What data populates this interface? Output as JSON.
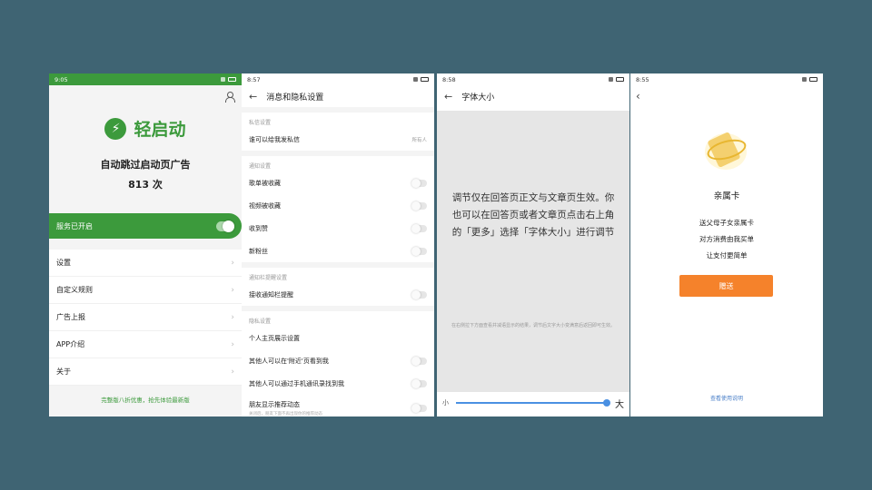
{
  "colors": {
    "background": "#3f6473",
    "accent_green": "#3c9a3c",
    "accent_orange": "#f5822b",
    "link_blue": "#4a7fc8",
    "slider_blue": "#4a90e2"
  },
  "phone1": {
    "time": "9:05",
    "brand_icon": "lightning-bolt-icon",
    "brand_name": "轻启动",
    "subtitle": "自动跳过启动页广告",
    "count": "813 次",
    "service_label": "服务已开启",
    "service_enabled": true,
    "menu": [
      {
        "label": "设置"
      },
      {
        "label": "自定义规则"
      },
      {
        "label": "广告上报"
      },
      {
        "label": "APP介绍"
      },
      {
        "label": "关于"
      }
    ],
    "footer": "完整版八折优惠，抢先体验最新版"
  },
  "phone2": {
    "time": "8:57",
    "title": "消息和隐私设置",
    "sections": {
      "private_msg_header": "私信设置",
      "private_msg_row": {
        "label": "谁可以给我发私信",
        "value": "所有人"
      },
      "notify_header": "通知设置",
      "notify_rows": [
        "歌单被收藏",
        "视频被收藏",
        "收到赞",
        "新粉丝"
      ],
      "bar_header": "通知栏提醒设置",
      "bar_row": "接收通知栏提醒",
      "privacy_header": "隐私设置",
      "privacy_rows": [
        "个人主页展示设置",
        "其他人可以在'附近'页看到我",
        "其他人可以通过手机通讯录找到我"
      ],
      "friend_row": {
        "label": "朋友显示推荐动态",
        "sub": "关闭后，朋友下面不再出现你的推荐动态"
      }
    }
  },
  "phone3": {
    "time": "8:58",
    "title": "字体大小",
    "main_text": "调节仅在回答页正文与文章页生效。你也可以在回答页或者文章页点击右上角的「更多」选择「字体大小」进行调节",
    "note": "在右侧拉下方面查看并减语显示的结果，调节后文字大小变满意后返回即可生效。",
    "slider_min": "小",
    "slider_max": "大",
    "slider_value": 1.0
  },
  "phone4": {
    "time": "8:55",
    "title": "亲属卡",
    "lines": [
      "送父母子女亲属卡",
      "对方消费由我买单",
      "让支付更简单"
    ],
    "button": "赠送",
    "link": "查看使用说明"
  }
}
